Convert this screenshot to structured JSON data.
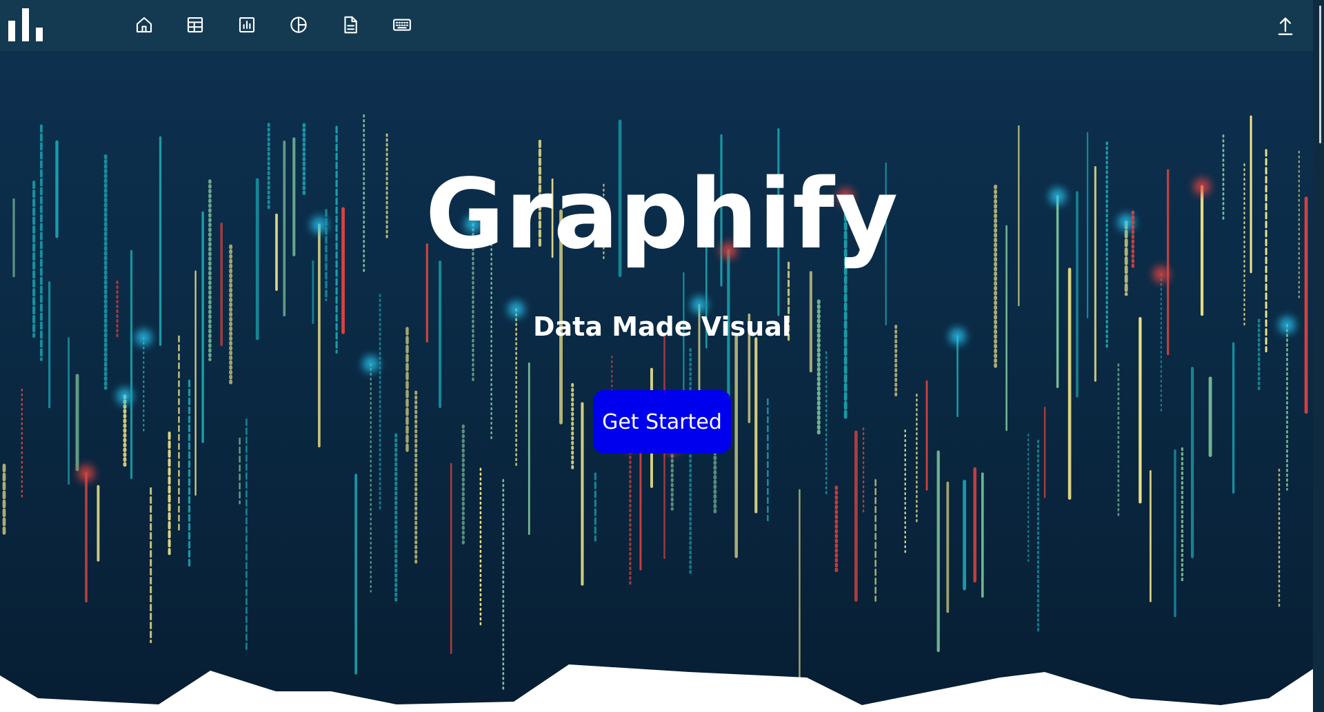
{
  "app": {
    "title": "Graphify",
    "tagline": "Data Made Visual",
    "cta_label": "Get Started"
  },
  "nav": {
    "items": [
      {
        "icon": "home-icon"
      },
      {
        "icon": "table-icon"
      },
      {
        "icon": "bar-chart-icon"
      },
      {
        "icon": "pie-chart-icon"
      },
      {
        "icon": "document-icon"
      },
      {
        "icon": "keyboard-icon"
      }
    ],
    "right_icon": "upload-icon"
  },
  "colors": {
    "background_top": "#0e3150",
    "background_bottom": "#071e33",
    "topbar": "#143a52",
    "button": "#0000ee",
    "line_red": "#e9453f",
    "line_yellow": "#f1e58a",
    "line_teal": "#1aa0ad",
    "line_green": "#7cc09a",
    "line_cyan": "#29c7f2"
  }
}
